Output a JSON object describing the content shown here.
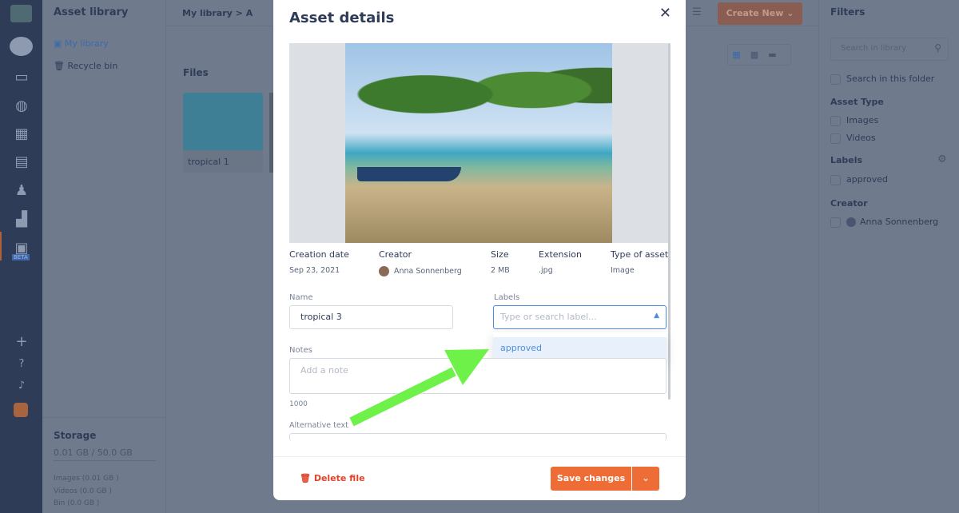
{
  "rail": {
    "beta": "BETA"
  },
  "library": {
    "title": "Asset library",
    "items": [
      {
        "label": "My library"
      },
      {
        "label": "Recycle bin"
      }
    ],
    "storage_title": "Storage",
    "storage_used": "0.01 GB / 50.0 GB",
    "storage_breakdown": [
      "Images (0.01 GB )",
      "Videos (0.0 GB )",
      "Bin (0.0 GB )"
    ]
  },
  "main": {
    "breadcrumb": [
      "My library",
      ">",
      "A"
    ],
    "files_title": "Files",
    "files": [
      {
        "name": "tropical 1"
      }
    ],
    "create_new": "Create New"
  },
  "filters": {
    "title": "Filters",
    "search_placeholder": "Search in library",
    "search_folder": "Search in this folder",
    "asset_type_title": "Asset Type",
    "asset_types": [
      "Images",
      "Videos"
    ],
    "labels_title": "Labels",
    "labels": [
      "approved"
    ],
    "creator_title": "Creator",
    "creators": [
      "Anna Sonnenberg"
    ]
  },
  "modal": {
    "title": "Asset details",
    "meta": [
      {
        "label": "Creation date",
        "value": "Sep 23, 2021"
      },
      {
        "label": "Creator",
        "value": "Anna Sonnenberg"
      },
      {
        "label": "Size",
        "value": "2 MB"
      },
      {
        "label": "Extension",
        "value": ".jpg"
      },
      {
        "label": "Type of asset",
        "value": "Image"
      }
    ],
    "name_label": "Name",
    "name_value": "tropical 3",
    "labels_label": "Labels",
    "labels_placeholder": "Type or search label...",
    "labels_options": [
      "approved"
    ],
    "notes_label": "Notes",
    "notes_placeholder": "Add a note",
    "notes_counter": "1000",
    "alt_label": "Alternative text",
    "delete": "Delete file",
    "save": "Save changes"
  },
  "colors": {
    "accent": "#ee6c36",
    "annotation_arrow": "#6ef24a",
    "link": "#4a8ee0"
  }
}
